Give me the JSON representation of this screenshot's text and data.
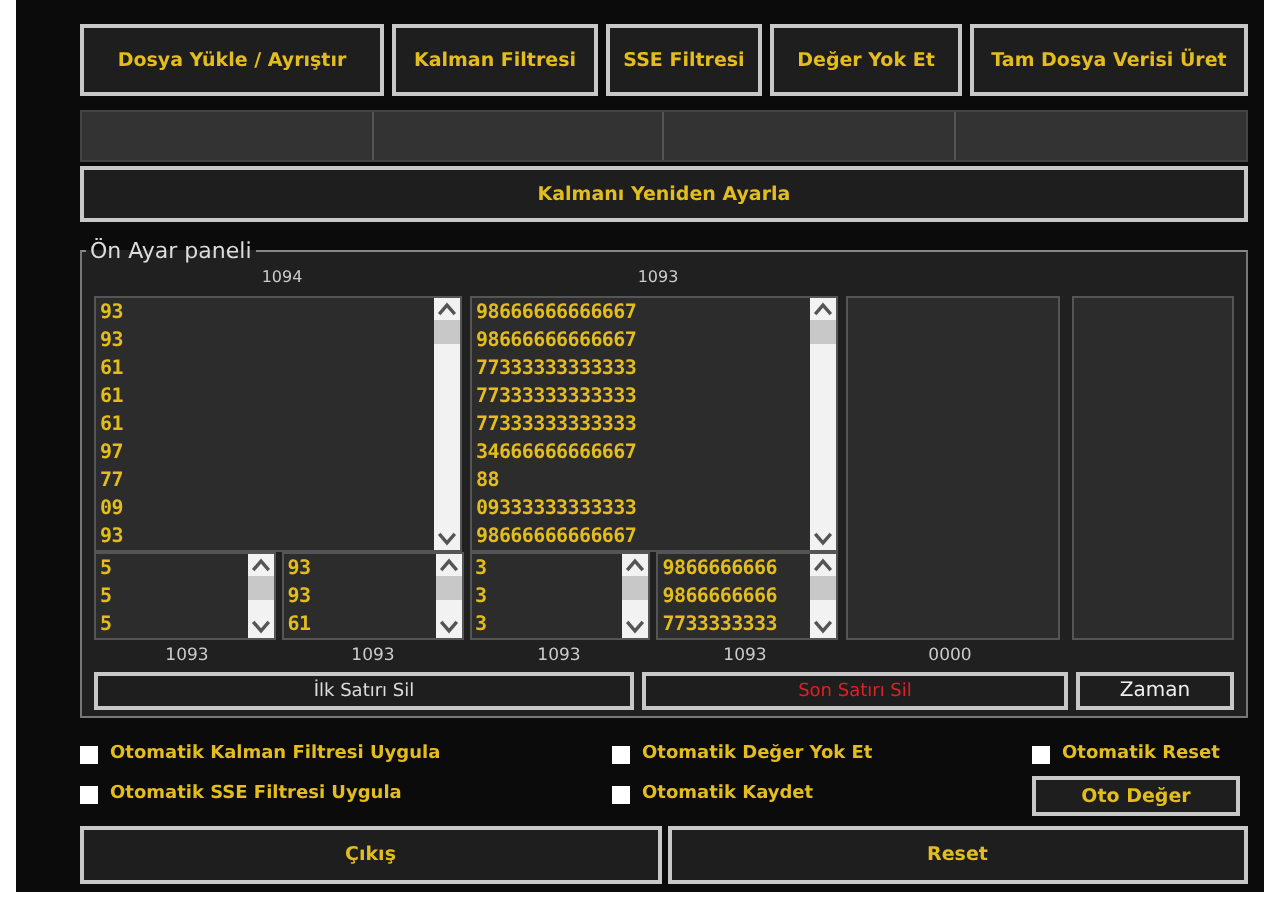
{
  "toolbar": [
    "Dosya Yükle / Ayrıştır",
    "Kalman Filtresi",
    "SSE Filtresi",
    "Değer Yok Et",
    "Tam Dosya Verisi Üret"
  ],
  "reset_kalman_button": "Kalmanı Yeniden Ayarla",
  "panel": {
    "title": "Ön Ayar paneli",
    "main_lists": [
      {
        "header": "1094",
        "rows": [
          "93",
          "93",
          "61",
          "61",
          "61",
          "97",
          "77",
          "09",
          "93"
        ]
      },
      {
        "header": "1093",
        "rows": [
          "98666666666667",
          "98666666666667",
          "77333333333333",
          "77333333333333",
          "77333333333333",
          "34666666666667",
          "88",
          "09333333333333",
          "98666666666667"
        ]
      }
    ],
    "small_lists": [
      {
        "rows": [
          "5",
          "5",
          "5"
        ],
        "footer": "1093"
      },
      {
        "rows": [
          "93",
          "93",
          "61"
        ],
        "footer": "1093"
      },
      {
        "rows": [
          "3",
          "3",
          "3"
        ],
        "footer": "1093"
      },
      {
        "rows": [
          "9866666666",
          "9866666666",
          "7733333333"
        ],
        "footer": "1093"
      }
    ],
    "blank_panel_footer": "0000",
    "row_buttons": [
      {
        "label": "İlk Satırı Sil",
        "kind": "normal"
      },
      {
        "label": "Son Satırı Sil",
        "kind": "danger"
      },
      {
        "label": "Zaman",
        "kind": "normal"
      }
    ]
  },
  "options": [
    {
      "label": "Otomatik Kalman Filtresi Uygula",
      "checked": false
    },
    {
      "label": "Otomatik Değer Yok Et",
      "checked": false
    },
    {
      "label": "Otomatik Reset",
      "checked": false
    },
    {
      "label": "Otomatik SSE Filtresi Uygula",
      "checked": false
    },
    {
      "label": "Otomatik Kaydet",
      "checked": false
    }
  ],
  "oto_button": "Oto Değer",
  "footer_buttons": [
    "Çıkış",
    "Reset"
  ]
}
